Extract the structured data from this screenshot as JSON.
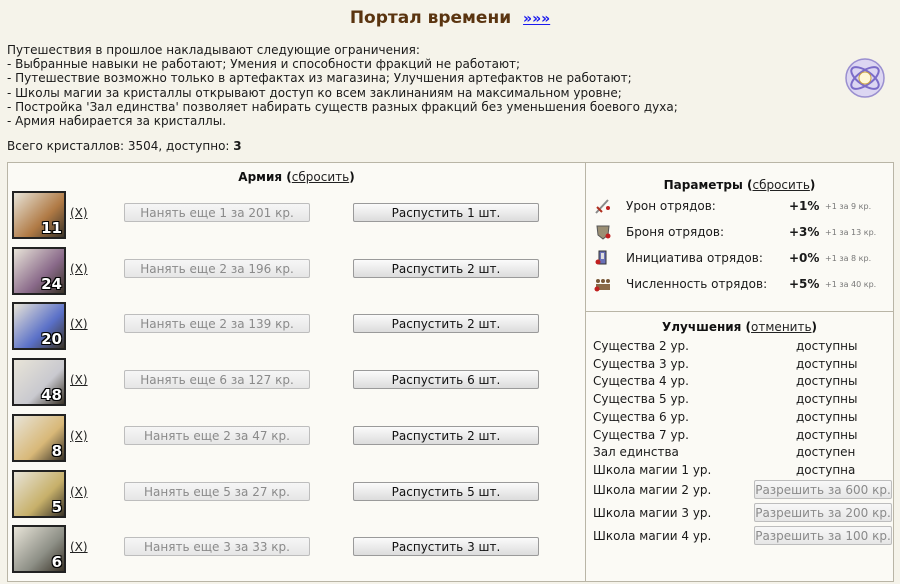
{
  "header": {
    "title": "Портал времени",
    "link": "»»»"
  },
  "restrictions": {
    "intro": "Путешествия в прошлое накладывают следующие ограничения:",
    "items": [
      "- Выбранные навыки не работают; Умения и способности фракций не работают;",
      "- Путешествие возможно только в артефактах из магазина; Улучшения артефактов не работают;",
      "- Школы магии за кристаллы открывают доступ ко всем заклинаниям на максимальном уровне;",
      "- Постройка 'Зал единства' позволяет набирать существ разных фракций без уменьшения боевого духа;",
      "- Армия набирается за кристаллы."
    ]
  },
  "crystals": {
    "label": "Всего кристаллов: 3504, доступно:",
    "available": "3"
  },
  "army": {
    "title": "Армия",
    "reset": "сбросить",
    "remove_label": "(X)",
    "units": [
      {
        "count": "11",
        "hire": "Нанять еще 1 за 201 кр.",
        "dismiss": "Распустить 1 шт.",
        "color": "#b07a45"
      },
      {
        "count": "24",
        "hire": "Нанять еще 2 за 196 кр.",
        "dismiss": "Распустить 2 шт.",
        "color": "#8a6a8a"
      },
      {
        "count": "20",
        "hire": "Нанять еще 2 за 139 кр.",
        "dismiss": "Распустить 2 шт.",
        "color": "#5a70c8"
      },
      {
        "count": "48",
        "hire": "Нанять еще 6 за 127 кр.",
        "dismiss": "Распустить 6 шт.",
        "color": "#c9c9cf"
      },
      {
        "count": "8",
        "hire": "Нанять еще 2 за 47 кр.",
        "dismiss": "Распустить 2 шт.",
        "color": "#d8b878"
      },
      {
        "count": "5",
        "hire": "Нанять еще 5 за 27 кр.",
        "dismiss": "Распустить 5 шт.",
        "color": "#c7b06a"
      },
      {
        "count": "6",
        "hire": "Нанять еще 3 за 33 кр.",
        "dismiss": "Распустить 3 шт.",
        "color": "#8d8f86"
      }
    ]
  },
  "params": {
    "title": "Параметры",
    "reset": "сбросить",
    "rows": [
      {
        "icon": "sword-damage-icon",
        "name": "Урон отрядов:",
        "value": "+1%",
        "sub": "+1 за 9 кр."
      },
      {
        "icon": "armor-icon",
        "name": "Броня отрядов:",
        "value": "+3%",
        "sub": "+1 за 13 кр."
      },
      {
        "icon": "initiative-icon",
        "name": "Инициатива отрядов:",
        "value": "+0%",
        "sub": "+1 за 8 кр."
      },
      {
        "icon": "army-size-icon",
        "name": "Численность отрядов:",
        "value": "+5%",
        "sub": "+1 за 40 кр."
      }
    ]
  },
  "upgrades": {
    "title": "Улучшения",
    "cancel": "отменить",
    "rows": [
      {
        "name": "Существа 2 ур.",
        "status": "доступны"
      },
      {
        "name": "Существа 3 ур.",
        "status": "доступны"
      },
      {
        "name": "Существа 4 ур.",
        "status": "доступны"
      },
      {
        "name": "Существа 5 ур.",
        "status": "доступны"
      },
      {
        "name": "Существа 6 ур.",
        "status": "доступны"
      },
      {
        "name": "Существа 7 ур.",
        "status": "доступны"
      },
      {
        "name": "Зал единства",
        "status": "доступен"
      },
      {
        "name": "Школа магии 1 ур.",
        "status": "доступна"
      },
      {
        "name": "Школа магии 2 ур.",
        "button": "Разрешить за 600 кр."
      },
      {
        "name": "Школа магии 3 ур.",
        "button": "Разрешить за 200 кр."
      },
      {
        "name": "Школа магии 4 ур.",
        "button": "Разрешить за 100 кр."
      }
    ]
  }
}
